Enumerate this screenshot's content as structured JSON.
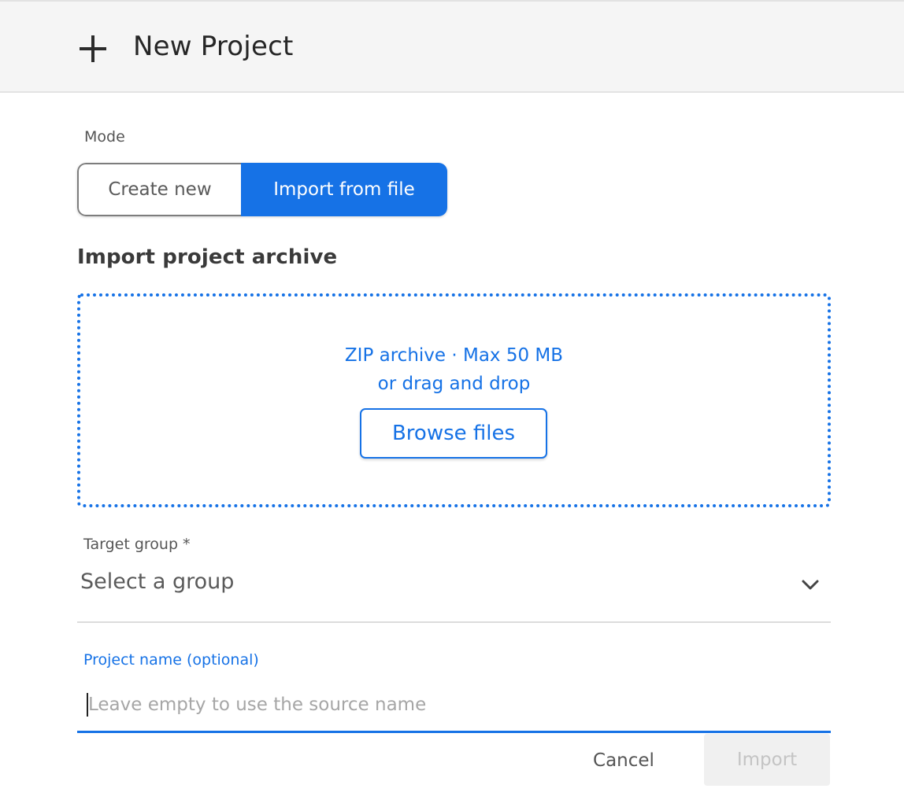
{
  "dialog": {
    "title": "New Project",
    "title_icon": "plus-icon"
  },
  "mode": {
    "label": "Mode",
    "options": [
      "Create new",
      "Import from file"
    ],
    "selected": "Import from file"
  },
  "import": {
    "section_title": "Import project archive",
    "dropzone": {
      "line1": "ZIP archive · Max 50 MB",
      "line2": "or drag and drop",
      "browse_label": "Browse files"
    }
  },
  "target_group": {
    "label": "Target group *",
    "value": "Select a group",
    "icon": "chevron-down-icon"
  },
  "project_name": {
    "label": "Project name (optional)",
    "value": "",
    "placeholder": "Leave empty to use the source name"
  },
  "footer": {
    "cancel_label": "Cancel",
    "import_label": "Import",
    "import_disabled": true
  },
  "colors": {
    "accent": "#1672e6",
    "header_bg": "#f5f5f5",
    "disabled_bg": "#f0f0f0",
    "disabled_text": "#c4c4c4"
  }
}
